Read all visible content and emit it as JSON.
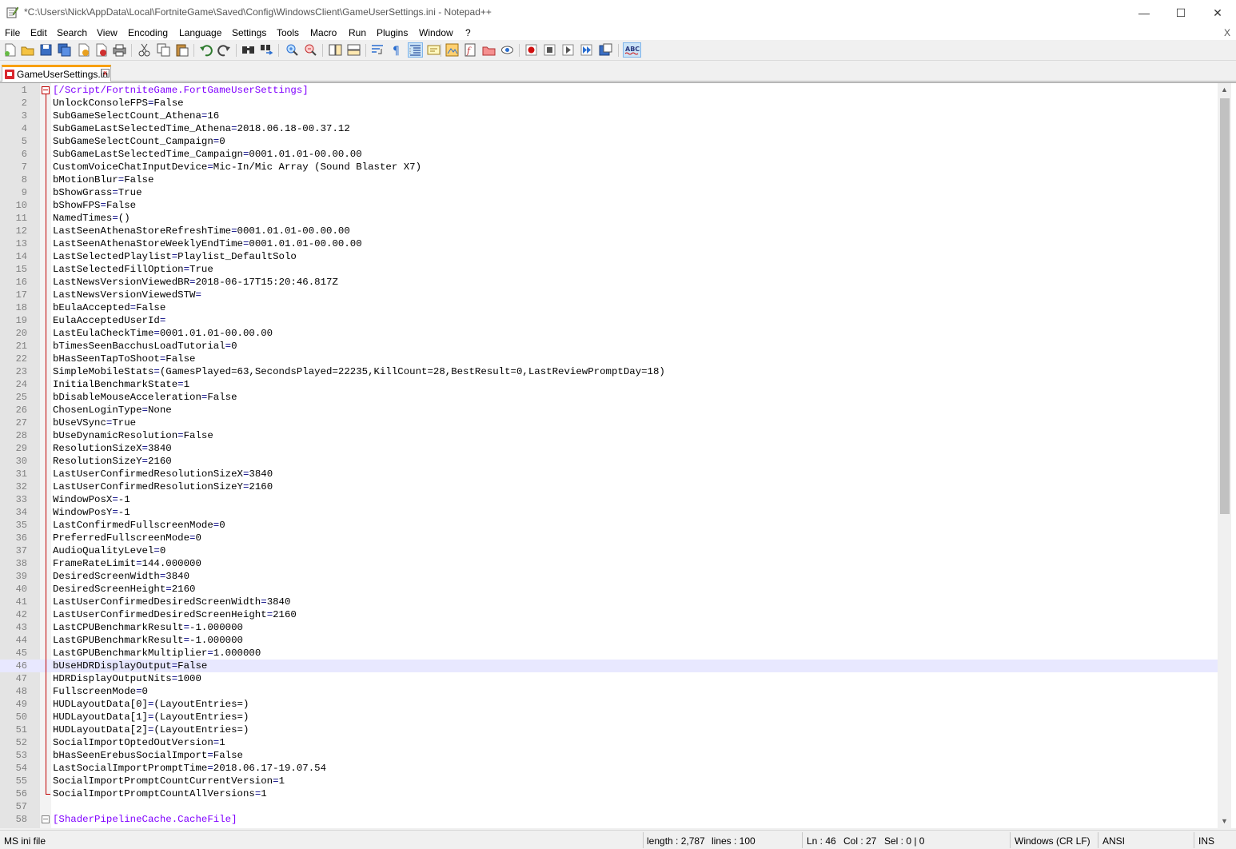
{
  "window": {
    "title": "*C:\\Users\\Nick\\AppData\\Local\\FortniteGame\\Saved\\Config\\WindowsClient\\GameUserSettings.ini - Notepad++",
    "minimize": "—",
    "maximize": "☐",
    "close": "✕"
  },
  "menu": {
    "items": [
      "File",
      "Edit",
      "Search",
      "View",
      "Encoding",
      "Language",
      "Settings",
      "Tools",
      "Macro",
      "Run",
      "Plugins",
      "Window",
      "?"
    ],
    "close_doc": "X"
  },
  "toolbar": {
    "icons": [
      "new-file-icon",
      "open-file-icon",
      "save-icon",
      "save-all-icon",
      "close-icon",
      "close-all-icon",
      "print-icon",
      "cut-icon",
      "copy-icon",
      "paste-icon",
      "undo-icon",
      "redo-icon",
      "find-icon",
      "replace-icon",
      "zoom-in-icon",
      "zoom-out-icon",
      "sync-vertical-icon",
      "sync-horizontal-icon",
      "word-wrap-icon",
      "show-all-chars-icon",
      "indent-guide-icon",
      "user-language-icon",
      "doc-map-icon",
      "function-list-icon",
      "folder-workspace-icon",
      "monitoring-icon",
      "record-macro-icon",
      "stop-record-icon",
      "play-macro-icon",
      "run-macro-multiple-icon",
      "save-macro-icon",
      "spell-check-icon"
    ]
  },
  "tab": {
    "label": "GameUserSettings.ini",
    "close": "x"
  },
  "editor": {
    "lines": [
      {
        "n": "1",
        "section": "[/Script/FortniteGame.FortGameUserSettings]"
      },
      {
        "n": "2",
        "key": "UnlockConsoleFPS",
        "value": "False"
      },
      {
        "n": "3",
        "key": "SubGameSelectCount_Athena",
        "value": "16"
      },
      {
        "n": "4",
        "key": "SubGameLastSelectedTime_Athena",
        "value": "2018.06.18-00.37.12"
      },
      {
        "n": "5",
        "key": "SubGameSelectCount_Campaign",
        "value": "0"
      },
      {
        "n": "6",
        "key": "SubGameLastSelectedTime_Campaign",
        "value": "0001.01.01-00.00.00"
      },
      {
        "n": "7",
        "key": "CustomVoiceChatInputDevice",
        "value": "Mic-In/Mic Array (Sound Blaster X7)"
      },
      {
        "n": "8",
        "key": "bMotionBlur",
        "value": "False"
      },
      {
        "n": "9",
        "key": "bShowGrass",
        "value": "True"
      },
      {
        "n": "10",
        "key": "bShowFPS",
        "value": "False"
      },
      {
        "n": "11",
        "key": "NamedTimes",
        "value": "()"
      },
      {
        "n": "12",
        "key": "LastSeenAthenaStoreRefreshTime",
        "value": "0001.01.01-00.00.00"
      },
      {
        "n": "13",
        "key": "LastSeenAthenaStoreWeeklyEndTime",
        "value": "0001.01.01-00.00.00"
      },
      {
        "n": "14",
        "key": "LastSelectedPlaylist",
        "value": "Playlist_DefaultSolo"
      },
      {
        "n": "15",
        "key": "LastSelectedFillOption",
        "value": "True"
      },
      {
        "n": "16",
        "key": "LastNewsVersionViewedBR",
        "value": "2018-06-17T15:20:46.817Z"
      },
      {
        "n": "17",
        "key": "LastNewsVersionViewedSTW",
        "value": ""
      },
      {
        "n": "18",
        "key": "bEulaAccepted",
        "value": "False"
      },
      {
        "n": "19",
        "key": "EulaAcceptedUserId",
        "value": ""
      },
      {
        "n": "20",
        "key": "LastEulaCheckTime",
        "value": "0001.01.01-00.00.00"
      },
      {
        "n": "21",
        "key": "bTimesSeenBacchusLoadTutorial",
        "value": "0"
      },
      {
        "n": "22",
        "key": "bHasSeenTapToShoot",
        "value": "False"
      },
      {
        "n": "23",
        "key": "SimpleMobileStats",
        "value": "(GamesPlayed=63,SecondsPlayed=22235,KillCount=28,BestResult=0,LastReviewPromptDay=18)"
      },
      {
        "n": "24",
        "key": "InitialBenchmarkState",
        "value": "1"
      },
      {
        "n": "25",
        "key": "bDisableMouseAcceleration",
        "value": "False"
      },
      {
        "n": "26",
        "key": "ChosenLoginType",
        "value": "None"
      },
      {
        "n": "27",
        "key": "bUseVSync",
        "value": "True"
      },
      {
        "n": "28",
        "key": "bUseDynamicResolution",
        "value": "False"
      },
      {
        "n": "29",
        "key": "ResolutionSizeX",
        "value": "3840"
      },
      {
        "n": "30",
        "key": "ResolutionSizeY",
        "value": "2160"
      },
      {
        "n": "31",
        "key": "LastUserConfirmedResolutionSizeX",
        "value": "3840"
      },
      {
        "n": "32",
        "key": "LastUserConfirmedResolutionSizeY",
        "value": "2160"
      },
      {
        "n": "33",
        "key": "WindowPosX",
        "value": "-1"
      },
      {
        "n": "34",
        "key": "WindowPosY",
        "value": "-1"
      },
      {
        "n": "35",
        "key": "LastConfirmedFullscreenMode",
        "value": "0"
      },
      {
        "n": "36",
        "key": "PreferredFullscreenMode",
        "value": "0"
      },
      {
        "n": "37",
        "key": "AudioQualityLevel",
        "value": "0"
      },
      {
        "n": "38",
        "key": "FrameRateLimit",
        "value": "144.000000"
      },
      {
        "n": "39",
        "key": "DesiredScreenWidth",
        "value": "3840"
      },
      {
        "n": "40",
        "key": "DesiredScreenHeight",
        "value": "2160"
      },
      {
        "n": "41",
        "key": "LastUserConfirmedDesiredScreenWidth",
        "value": "3840"
      },
      {
        "n": "42",
        "key": "LastUserConfirmedDesiredScreenHeight",
        "value": "2160"
      },
      {
        "n": "43",
        "key": "LastCPUBenchmarkResult",
        "value": "-1.000000"
      },
      {
        "n": "44",
        "key": "LastGPUBenchmarkResult",
        "value": "-1.000000"
      },
      {
        "n": "45",
        "key": "LastGPUBenchmarkMultiplier",
        "value": "1.000000"
      },
      {
        "n": "46",
        "key": "bUseHDRDisplayOutput",
        "value": "False",
        "current": true
      },
      {
        "n": "47",
        "key": "HDRDisplayOutputNits",
        "value": "1000"
      },
      {
        "n": "48",
        "key": "FullscreenMode",
        "value": "0"
      },
      {
        "n": "49",
        "key": "HUDLayoutData[0]",
        "value": "(LayoutEntries=)"
      },
      {
        "n": "50",
        "key": "HUDLayoutData[1]",
        "value": "(LayoutEntries=)"
      },
      {
        "n": "51",
        "key": "HUDLayoutData[2]",
        "value": "(LayoutEntries=)"
      },
      {
        "n": "52",
        "key": "SocialImportOptedOutVersion",
        "value": "1"
      },
      {
        "n": "53",
        "key": "bHasSeenErebusSocialImport",
        "value": "False"
      },
      {
        "n": "54",
        "key": "LastSocialImportPromptTime",
        "value": "2018.06.17-19.07.54"
      },
      {
        "n": "55",
        "key": "SocialImportPromptCountCurrentVersion",
        "value": "1"
      },
      {
        "n": "56",
        "key": "SocialImportPromptCountAllVersions",
        "value": "1"
      },
      {
        "n": "57",
        "blank": true
      },
      {
        "n": "58",
        "section": "[ShaderPipelineCache.CacheFile]"
      }
    ]
  },
  "scrollbar": {
    "up": "▲",
    "down": "▼"
  },
  "status": {
    "language": "MS ini file",
    "length": "length : 2,787",
    "lines": "lines : 100",
    "ln": "Ln : 46",
    "col": "Col : 27",
    "sel": "Sel : 0 | 0",
    "eol": "Windows (CR LF)",
    "encoding": "ANSI",
    "mode": "INS"
  },
  "colors": {
    "section": "#8000ff",
    "operator": "#000080",
    "fold": "#c00000",
    "current_line": "#e8e8ff",
    "tab_accent": "#f8a000"
  }
}
